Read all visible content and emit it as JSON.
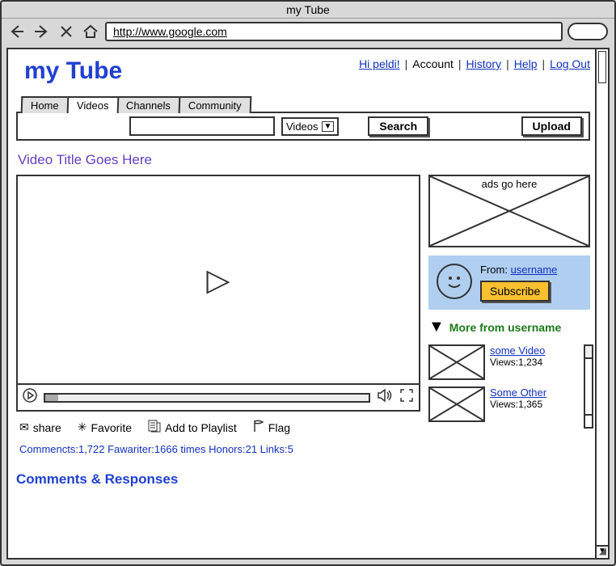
{
  "window": {
    "title": "my Tube",
    "url": "http://www.google.com"
  },
  "logo": "my Tube",
  "top_links": {
    "greeting": "Hi peldi!",
    "account": "Account",
    "history": "History",
    "help": "Help",
    "logout": "Log Out"
  },
  "tabs": {
    "home": "Home",
    "videos": "Videos",
    "channels": "Channels",
    "community": "Community"
  },
  "search": {
    "filter": "Videos",
    "search_btn": "Search",
    "upload_btn": "Upload"
  },
  "video": {
    "title": "Video Title Goes Here"
  },
  "actions": {
    "share": "share",
    "favorite": "Favorite",
    "playlist": "Add to Playlist",
    "flag": "Flag"
  },
  "stats_line": "Commencts:1,722 Fawariter:1666 times Honors:21 Links:5",
  "comments_heading": "Comments & Responses",
  "rightcol": {
    "ad_label": "ads go here",
    "from_label": "From:",
    "username": "username",
    "subscribe": "Subscribe",
    "more_from": "More from username",
    "items": [
      {
        "title": "some Video",
        "views": "Views:1,234"
      },
      {
        "title": "Some Other",
        "views": "Views:1,365"
      }
    ]
  }
}
